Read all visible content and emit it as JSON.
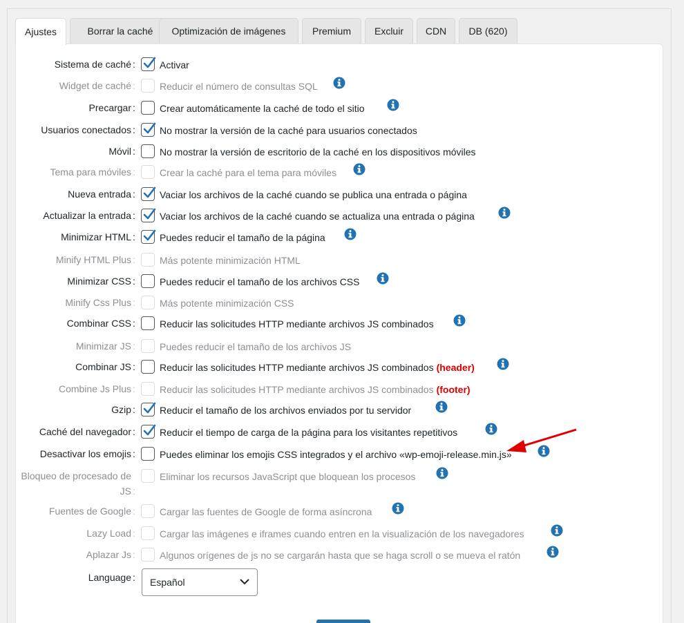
{
  "tabs": [
    "Ajustes",
    "Borrar la caché",
    "Optimización de imágenes",
    "Premium",
    "Excluir",
    "CDN",
    "DB (620)"
  ],
  "settings": [
    {
      "label": "Sistema de caché",
      "desc": "Activar",
      "checked": true,
      "disabled": false,
      "info": false
    },
    {
      "label": "Widget de caché",
      "desc": "Reducir el número de consultas SQL",
      "checked": false,
      "disabled": true,
      "info": true
    },
    {
      "label": "Precargar",
      "desc": "Crear automáticamente la caché de todo el sitio",
      "checked": false,
      "disabled": false,
      "info": true
    },
    {
      "label": "Usuarios conectados",
      "desc": "No mostrar la versión de la caché para usuarios conectados",
      "checked": true,
      "disabled": false,
      "info": false
    },
    {
      "label": "Móvil",
      "desc": "No mostrar la versión de escritorio de la caché en los dispositivos móviles",
      "checked": false,
      "disabled": false,
      "info": false
    },
    {
      "label": "Tema para móviles",
      "desc": "Crear la caché para el tema para móviles",
      "checked": false,
      "disabled": true,
      "info": true
    },
    {
      "label": "Nueva entrada",
      "desc": "Vaciar los archivos de la caché cuando se publica una entrada o página",
      "checked": true,
      "disabled": false,
      "info": false
    },
    {
      "label": "Actualizar la entrada",
      "desc": "Vaciar los archivos de la caché cuando se actualiza una entrada o página",
      "checked": true,
      "disabled": false,
      "info": true
    },
    {
      "label": "Minimizar HTML",
      "desc": "Puedes reducir el tamaño de la página",
      "checked": true,
      "disabled": false,
      "info": true
    },
    {
      "label": "Minify HTML Plus",
      "desc": "Más potente minimización HTML",
      "checked": false,
      "disabled": true,
      "info": false
    },
    {
      "label": "Minimizar CSS",
      "desc": "Puedes reducir el tamaño de los archivos CSS",
      "checked": false,
      "disabled": false,
      "info": true
    },
    {
      "label": "Minify Css Plus",
      "desc": "Más potente minimización CSS",
      "checked": false,
      "disabled": true,
      "info": false
    },
    {
      "label": "Combinar CSS",
      "desc": "Reducir las solicitudes HTTP mediante archivos JS combinados",
      "checked": false,
      "disabled": false,
      "info": true
    },
    {
      "label": "Minimizar JS",
      "desc": "Puedes reducir el tamaño de los archivos JS",
      "checked": false,
      "disabled": true,
      "info": false
    },
    {
      "label": "Combinar JS",
      "desc": "Reducir las solicitudes HTTP mediante archivos JS combinados",
      "tag": "(header)",
      "checked": false,
      "disabled": false,
      "info": true
    },
    {
      "label": "Combine Js Plus",
      "desc": "Reducir las solicitudes HTTP mediante archivos JS combinados",
      "tag": "(footer)",
      "checked": false,
      "disabled": true,
      "info": false
    },
    {
      "label": "Gzip",
      "desc": "Reducir el tamaño de los archivos enviados por tu servidor",
      "checked": true,
      "disabled": false,
      "info": true
    },
    {
      "label": "Caché del navegador",
      "desc": "Reducir el tiempo de carga de la página para los visitantes repetitivos",
      "checked": true,
      "disabled": false,
      "info": true
    },
    {
      "label": "Desactivar los emojis",
      "desc": "Puedes eliminar los emojis CSS integrados y el archivo «wp-emoji-release.min.js»",
      "checked": false,
      "disabled": false,
      "info": true
    },
    {
      "label": "Bloqueo de procesado de JS",
      "desc": "Eliminar los recursos JavaScript que bloquean los procesos",
      "checked": false,
      "disabled": true,
      "info": true
    },
    {
      "label": "Fuentes de Google",
      "desc": "Cargar las fuentes de Google de forma asíncrona",
      "checked": false,
      "disabled": true,
      "info": true
    },
    {
      "label": "Lazy Load",
      "desc": "Cargar las imágenes e iframes cuando entren en la visualización de los navegadores",
      "checked": false,
      "disabled": true,
      "info": true
    },
    {
      "label": "Aplazar Js",
      "desc": "Algunos orígenes de js no se cargarán hasta que se haga scroll o se mueva el ratón",
      "checked": false,
      "disabled": true,
      "info": true
    }
  ],
  "language": {
    "label": "Language",
    "selected": "Español"
  },
  "colors": {
    "accent": "#2271b1",
    "checkmark": "#2271b1",
    "tag": "#dc0000",
    "annotation_arrow": "#e00000"
  }
}
